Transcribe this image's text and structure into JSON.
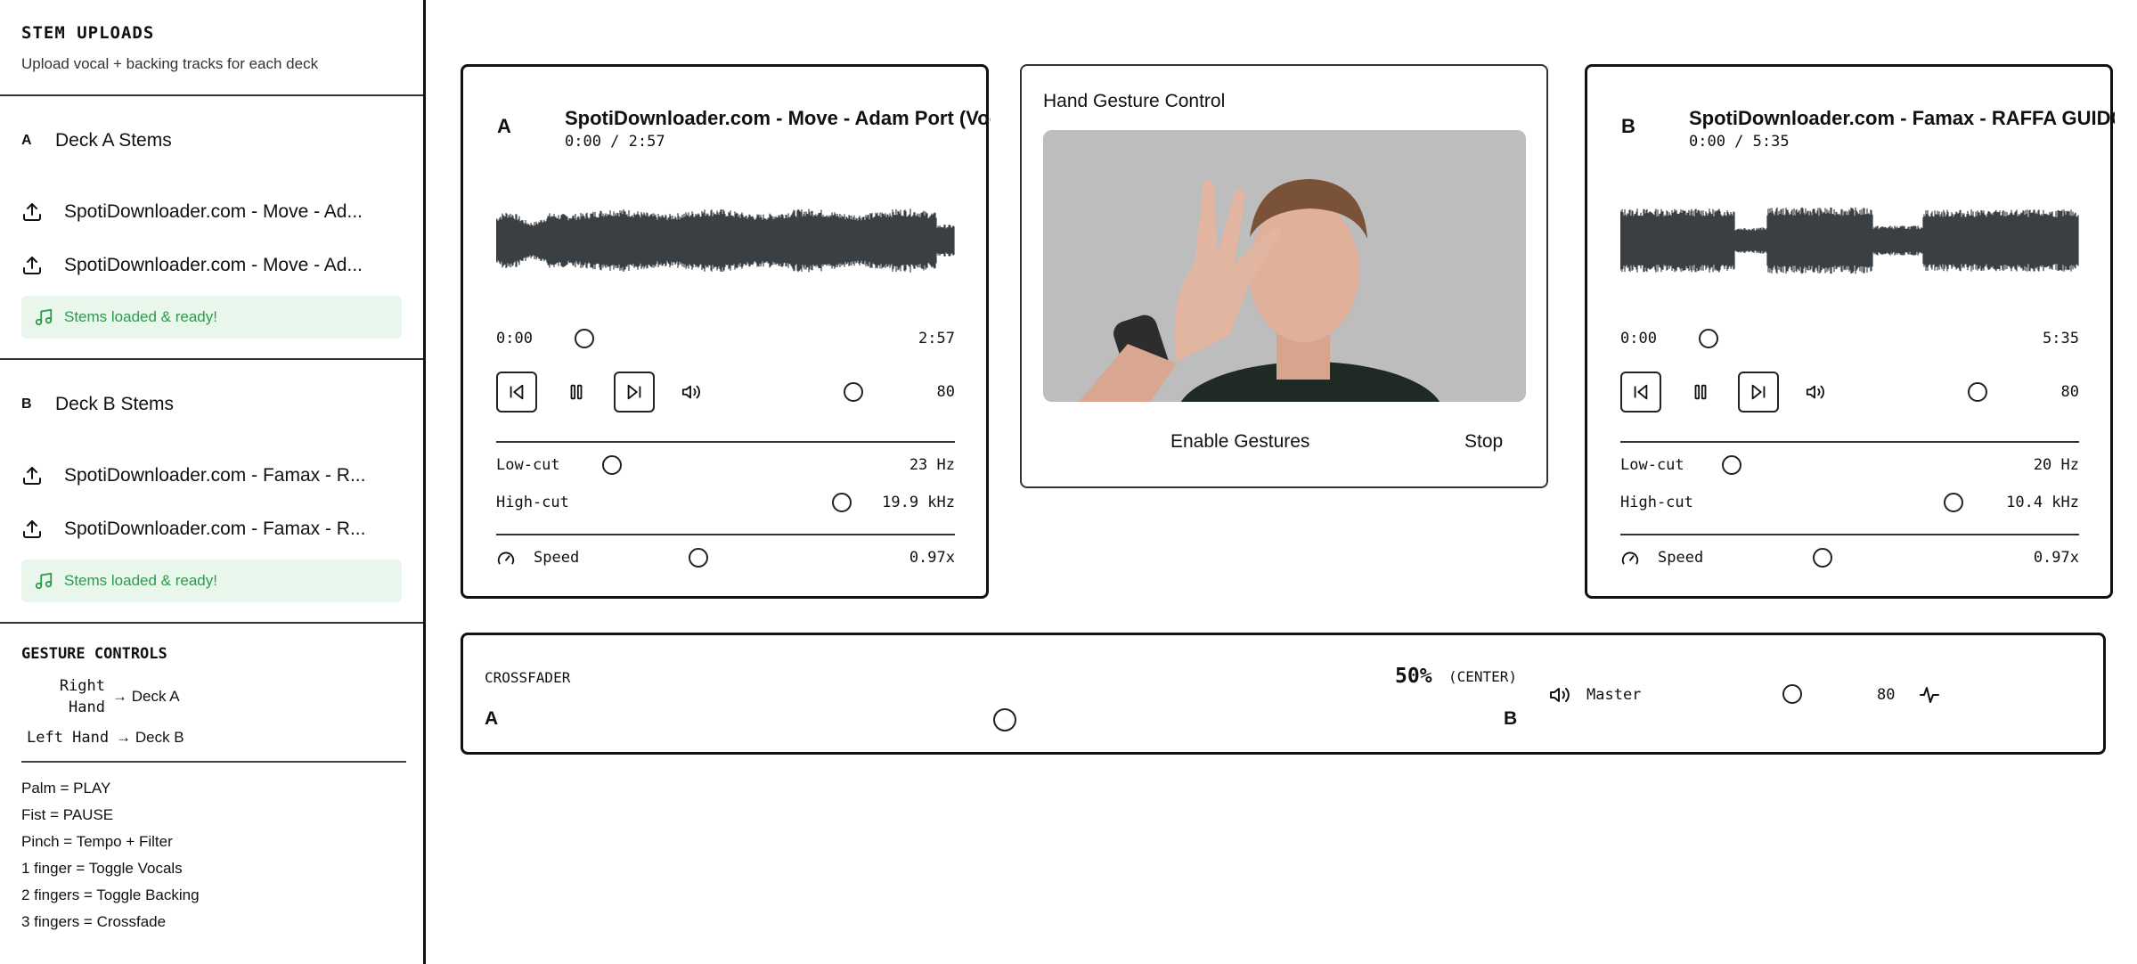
{
  "sidebar": {
    "title": "STEM UPLOADS",
    "subtitle": "Upload vocal + backing tracks for each deck",
    "deck_a": {
      "letter": "A",
      "title": "Deck A Stems",
      "stems": [
        "SpotiDownloader.com - Move - Ad...",
        "SpotiDownloader.com - Move - Ad..."
      ],
      "status": "Stems loaded & ready!"
    },
    "deck_b": {
      "letter": "B",
      "title": "Deck B Stems",
      "stems": [
        "SpotiDownloader.com - Famax - R...",
        "SpotiDownloader.com - Famax - R..."
      ],
      "status": "Stems loaded & ready!"
    },
    "gestures": {
      "title": "GESTURE CONTROLS",
      "mapping": [
        {
          "key": "Right Hand",
          "value": "→ Deck A"
        },
        {
          "key": "Left Hand",
          "value": "→ Deck B"
        }
      ],
      "rules": [
        "Palm = PLAY",
        "Fist = PAUSE",
        "Pinch = Tempo + Filter",
        "1 finger = Toggle Vocals",
        "2 fingers = Toggle Backing",
        "3 fingers = Crossfade"
      ]
    }
  },
  "deck_a": {
    "letter": "A",
    "title": "SpotiDownloader.com - Move - Adam Port (Vocals",
    "time": "0:00 / 2:57",
    "pos_start": "0:00",
    "pos_end": "2:57",
    "position_fraction": 0.0,
    "volume": "80",
    "lowcut_label": "Low-cut",
    "lowcut_value": "23 Hz",
    "highcut_label": "High-cut",
    "highcut_value": "19.9 kHz",
    "speed_label": "Speed",
    "speed_value": "0.97x"
  },
  "deck_b": {
    "letter": "B",
    "title": "SpotiDownloader.com - Famax - RAFFA GUIDO (Vo",
    "time": "0:00 / 5:35",
    "pos_start": "0:00",
    "pos_end": "5:35",
    "position_fraction": 0.0,
    "volume": "80",
    "lowcut_label": "Low-cut",
    "lowcut_value": "20 Hz",
    "highcut_label": "High-cut",
    "highcut_value": "10.4 kHz",
    "speed_label": "Speed",
    "speed_value": "0.97x"
  },
  "gesture_card": {
    "title": "Hand Gesture Control",
    "enable_label": "Enable Gestures",
    "stop_label": "Stop"
  },
  "crossfader": {
    "label": "CROSSFADER",
    "left": "A",
    "right": "B",
    "percent": "50%",
    "position_text": "(CENTER)",
    "master_label": "Master",
    "master_value": "80"
  },
  "colors": {
    "accent_green": "#2f9a4b",
    "ready_bg": "#e8f6ec",
    "waveform": "#3a3f44",
    "border": "#111111"
  }
}
